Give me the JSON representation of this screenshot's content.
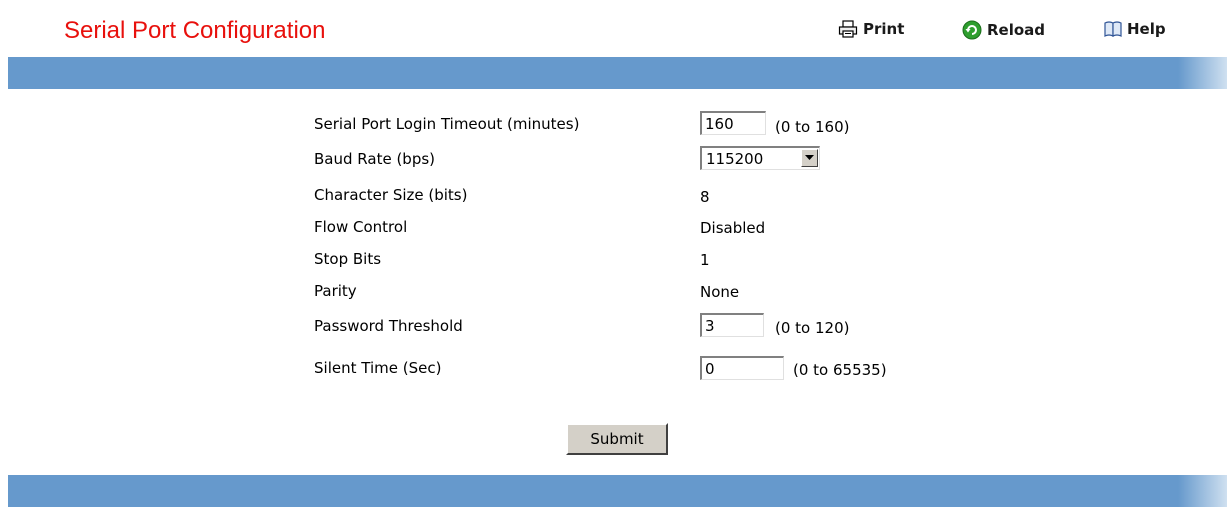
{
  "header": {
    "title": "Serial Port Configuration",
    "print_label": "Print",
    "reload_label": "Reload",
    "help_label": "Help"
  },
  "form": {
    "login_timeout": {
      "label": "Serial Port Login Timeout (minutes)",
      "value": "160",
      "range": "(0 to 160)"
    },
    "baud_rate": {
      "label": "Baud Rate (bps)",
      "selected": "115200"
    },
    "character_size": {
      "label": "Character Size (bits)",
      "value": "8"
    },
    "flow_control": {
      "label": "Flow Control",
      "value": "Disabled"
    },
    "stop_bits": {
      "label": "Stop Bits",
      "value": "1"
    },
    "parity": {
      "label": "Parity",
      "value": "None"
    },
    "password_threshold": {
      "label": "Password Threshold",
      "value": "3",
      "range": "(0 to 120)"
    },
    "silent_time": {
      "label": "Silent Time (Sec)",
      "value": "0",
      "range": "(0 to 65535)"
    },
    "submit_label": "Submit"
  },
  "colors": {
    "title": "#e8100c",
    "band": "#6699cc",
    "button_face": "#d4d0c8"
  },
  "icons": {
    "print": "printer-icon",
    "reload": "reload-icon",
    "help": "help-book-icon",
    "select_arrow": "chevron-down-icon"
  }
}
